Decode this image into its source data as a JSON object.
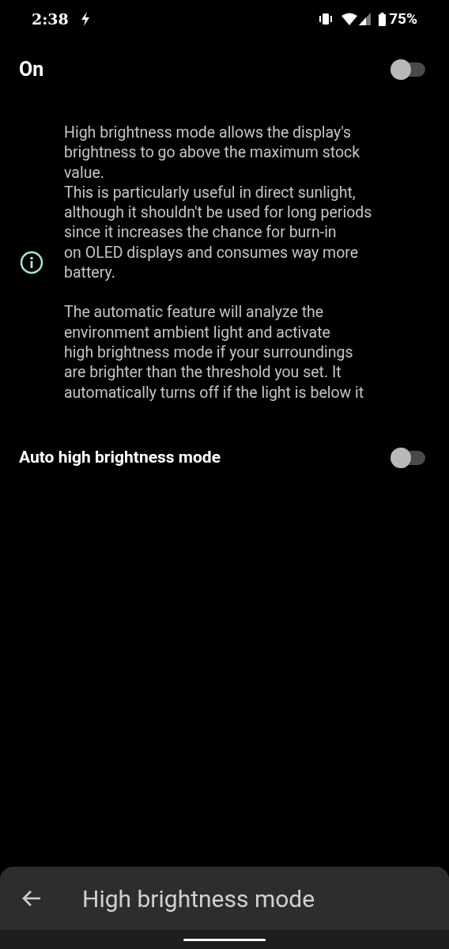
{
  "status_bar": {
    "time": "2:38",
    "battery": "75%"
  },
  "main_switch": {
    "label": "On",
    "on": false
  },
  "info": {
    "paragraphs": [
      "High brightness mode allows the display's\nbrightness to go above the maximum stock\nvalue.\nThis is particularly useful in direct sunlight,\nalthough it shouldn't be used for long periods\nsince it increases the chance for burn-in\non OLED displays and consumes way more\nbattery.",
      "The automatic feature will analyze the\nenvironment ambient light and activate\nhigh brightness mode if your surroundings\nare brighter than the threshold you set. It\nautomatically turns off if the light is below it"
    ]
  },
  "auto_switch": {
    "label": "Auto high brightness mode",
    "on": false
  },
  "bottom_bar": {
    "title": "High brightness mode"
  }
}
